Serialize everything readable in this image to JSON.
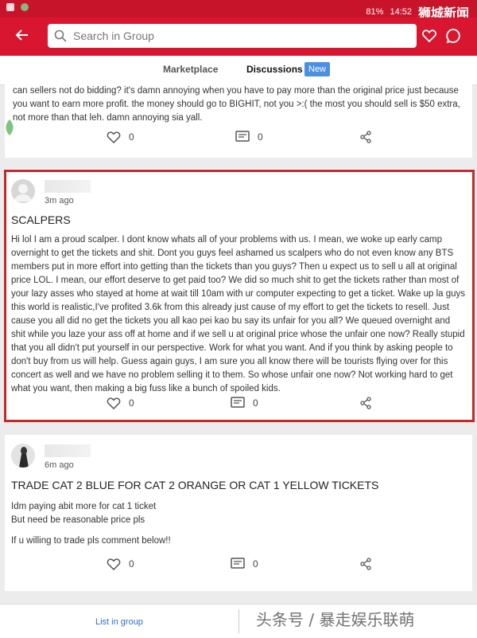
{
  "status": {
    "time": "14:52",
    "battery": "81%",
    "watermark": "狮城新闻"
  },
  "search": {
    "placeholder": "Search in Group"
  },
  "tabs": [
    {
      "label": "Marketplace"
    },
    {
      "label": "Discussions"
    }
  ],
  "badge": "New",
  "posts": [
    {
      "body": "can sellers not do bidding? it's damn annoying when you have to pay more than the original price just because you want to earn more profit. the money should go to BIGHIT, not you >:( the most you should sell is $50 extra, not more than that leh. damn annoying sia yall.",
      "likes": "0",
      "comments": "0"
    },
    {
      "time": "3m ago",
      "title": "SCALPERS",
      "body": "Hi lol I am a proud scalper. I dont know whats all of your problems with us. I mean, we woke up early camp overnight to get the tickets and shit. Dont you guys feel ashamed us scalpers who do not even know any BTS members put in more effort into getting than the tickets than you guys? Then u expect us to sell u all at original price LOL. I mean, our effort deserve to get paid too? We did so much shit to get the tickets rather than most of your lazy asses who stayed at home at wait till 10am with ur computer expecting to get a ticket. Wake up la guys this world is realistic,I've profited 3.6k from this already just cause of my effort to get the tickets to resell. Just cause you all did no get the tickets you all kao pei kao bu say its unfair for you all? We queued overnight and shit while you laze your ass off at home and if we sell u at original price whose the unfair one now? Really stupid that you all didn't put yourself in our perspective. Work for what you want. And if you think by asking people to don't buy from us will help. Guess again guys, I am sure you all know there will be tourists flying over for this concert as well and we have no problem selling it to them. So whose unfair one now? Not working hard to get what you want, then making a big fuss like a bunch of spoiled kids.",
      "likes": "0",
      "comments": "0"
    },
    {
      "time": "6m ago",
      "title": "TRADE CAT 2 BLUE FOR CAT 2 ORANGE OR CAT 1 YELLOW TICKETS",
      "lines": [
        "Idm paying abit more for cat 1 ticket",
        "But need be reasonable price pls",
        "",
        "If u willing to trade pls comment below!!"
      ],
      "likes": "0",
      "comments": "0"
    }
  ],
  "bottom": {
    "list_label": "List in group",
    "watermark": "头条号 / 暴走娱乐联萌"
  },
  "colors": {
    "brand_red": "#d9162f",
    "highlight_border": "#c62828",
    "link_blue": "#2e6fd0"
  }
}
